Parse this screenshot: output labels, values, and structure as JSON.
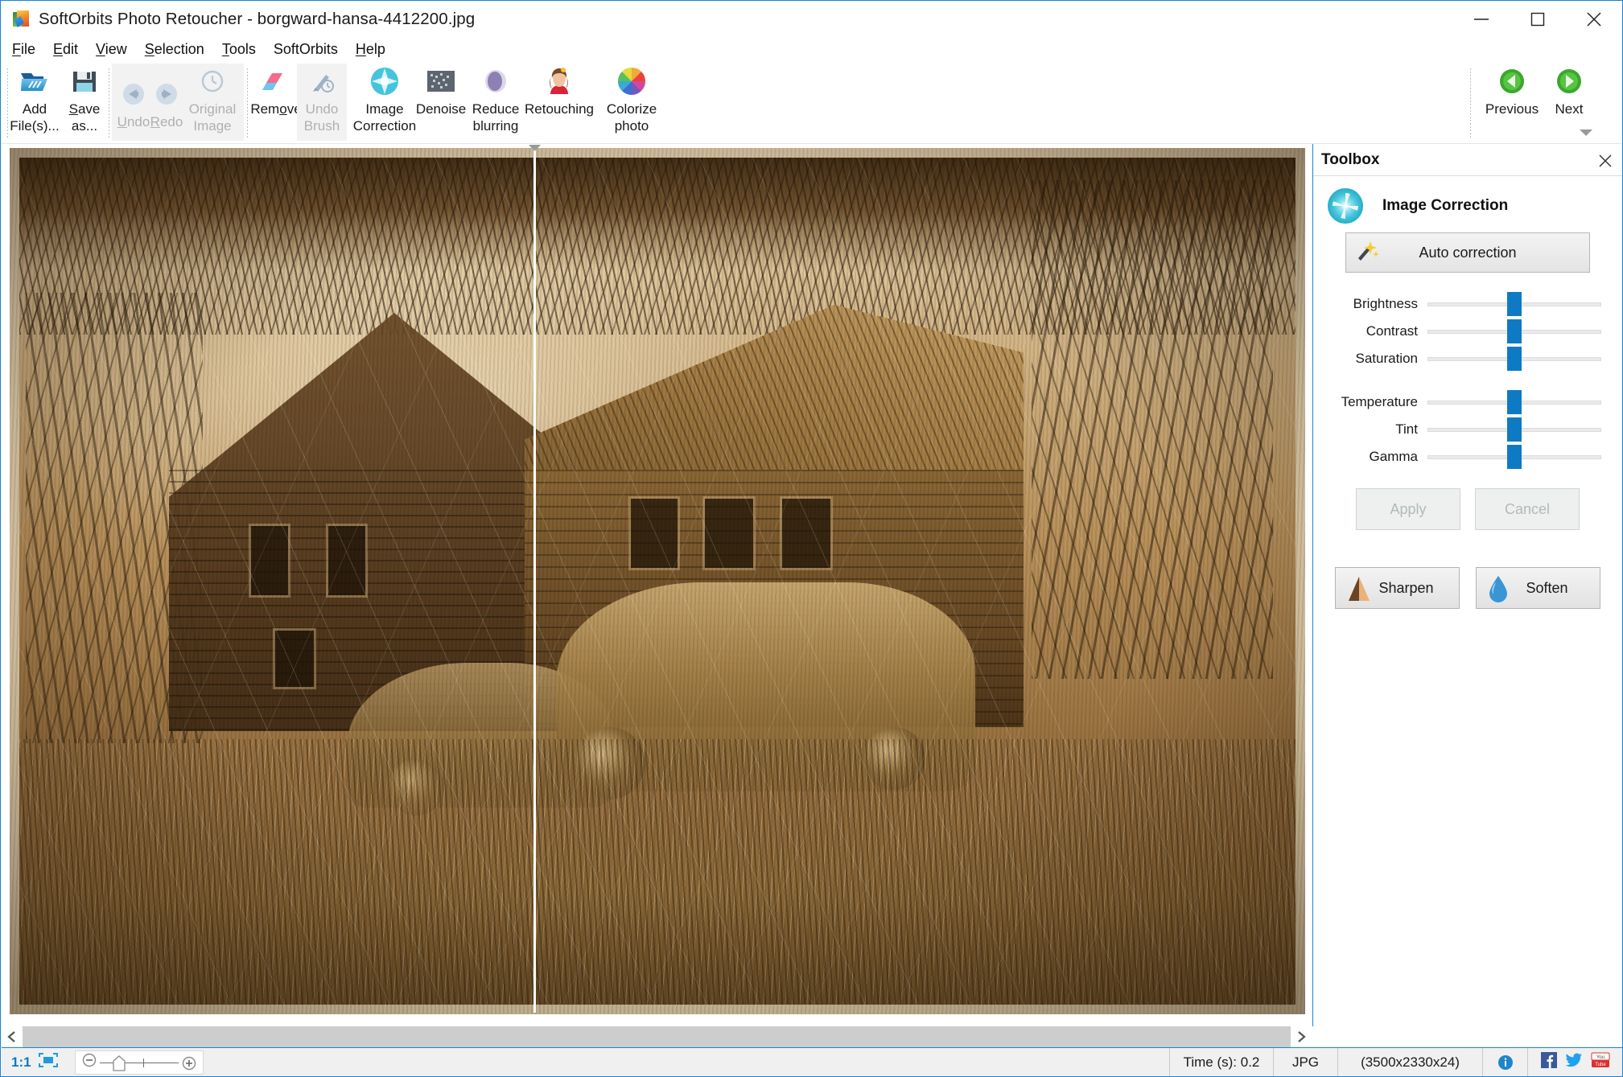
{
  "window": {
    "title": "SoftOrbits Photo Retoucher - borgward-hansa-4412200.jpg",
    "app_icon": "softorbits-logo-icon",
    "controls": {
      "minimize": "minimize-icon",
      "maximize": "maximize-icon",
      "close": "close-icon"
    }
  },
  "menubar": {
    "items": [
      {
        "label": "File",
        "accel": "F"
      },
      {
        "label": "Edit",
        "accel": "E"
      },
      {
        "label": "View",
        "accel": "V"
      },
      {
        "label": "Selection",
        "accel": "S"
      },
      {
        "label": "Tools",
        "accel": "T"
      },
      {
        "label": "SoftOrbits",
        "accel": ""
      },
      {
        "label": "Help",
        "accel": "H"
      }
    ]
  },
  "ribbon": {
    "buttons": [
      {
        "label": "Add\nFile(s)...",
        "icon": "open-folder-icon",
        "enabled": true
      },
      {
        "label": "Save\nas...",
        "icon": "floppy-save-icon",
        "enabled": true
      },
      {
        "label": "Undo",
        "icon": "undo-arrow-icon",
        "enabled": false
      },
      {
        "label": "Redo",
        "icon": "redo-arrow-icon",
        "enabled": false
      },
      {
        "label": "Original\nImage",
        "icon": "clock-history-icon",
        "enabled": false
      },
      {
        "label": "Remove",
        "icon": "eraser-icon",
        "enabled": true
      },
      {
        "label": "Undo\nBrush",
        "icon": "brush-clock-icon",
        "enabled": false
      },
      {
        "label": "Image\nCorrection",
        "icon": "image-correction-star-icon",
        "enabled": true
      },
      {
        "label": "Denoise",
        "icon": "denoise-grid-icon",
        "enabled": true
      },
      {
        "label": "Reduce\nblurring",
        "icon": "blur-circle-icon",
        "enabled": true
      },
      {
        "label": "Retouching",
        "icon": "portrait-woman-icon",
        "enabled": true
      },
      {
        "label": "Colorize\nphoto",
        "icon": "color-wheel-icon",
        "enabled": true
      }
    ],
    "navigation": [
      {
        "label": "Previous",
        "icon": "green-left-arrow-icon",
        "enabled": true
      },
      {
        "label": "Next",
        "icon": "green-right-arrow-icon",
        "enabled": true
      }
    ],
    "expander_icon": "ribbon-expand-icon"
  },
  "canvas": {
    "photo_alt": "sepia photo of abandoned farmhouse and vintage car",
    "split_handle_icon": "split-compare-handle-icon",
    "scrollbar": {
      "left_arrow": "chevron-left-icon",
      "right_arrow": "chevron-right-icon"
    }
  },
  "toolbox": {
    "title": "Toolbox",
    "close_icon": "close-icon",
    "section": {
      "title": "Image Correction",
      "icon": "image-correction-star-icon"
    },
    "auto_correction": {
      "label": "Auto correction",
      "icon": "magic-wand-icon"
    },
    "sliders": [
      {
        "label": "Brightness",
        "value": 50,
        "min": 0,
        "max": 100
      },
      {
        "label": "Contrast",
        "value": 50,
        "min": 0,
        "max": 100
      },
      {
        "label": "Saturation",
        "value": 50,
        "min": 0,
        "max": 100
      },
      {
        "label": "Temperature",
        "value": 50,
        "min": 0,
        "max": 100
      },
      {
        "label": "Tint",
        "value": 50,
        "min": 0,
        "max": 100
      },
      {
        "label": "Gamma",
        "value": 50,
        "min": 0,
        "max": 100
      }
    ],
    "apply_label": "Apply",
    "cancel_label": "Cancel",
    "sharpen": {
      "label": "Sharpen",
      "icon": "sharpen-triangle-icon"
    },
    "soften": {
      "label": "Soften",
      "icon": "water-drop-icon"
    }
  },
  "statusbar": {
    "zoom_ratio": "1:1",
    "fit_icon": "fit-to-window-icon",
    "zoom_out_icon": "zoom-out-icon",
    "zoom_in_icon": "zoom-in-icon",
    "time": "Time (s): 0.2",
    "format": "JPG",
    "dimensions": "(3500x2330x24)",
    "info_icon": "info-icon",
    "facebook_icon": "facebook-icon",
    "twitter_icon": "twitter-icon",
    "youtube_icon": "youtube-icon"
  },
  "colors": {
    "accent_blue": "#1883d7",
    "slider_blue": "#0e7ac4",
    "ribbon_group_bg": "#f2f2f2",
    "statusbar_bg": "#f0f0f0"
  }
}
